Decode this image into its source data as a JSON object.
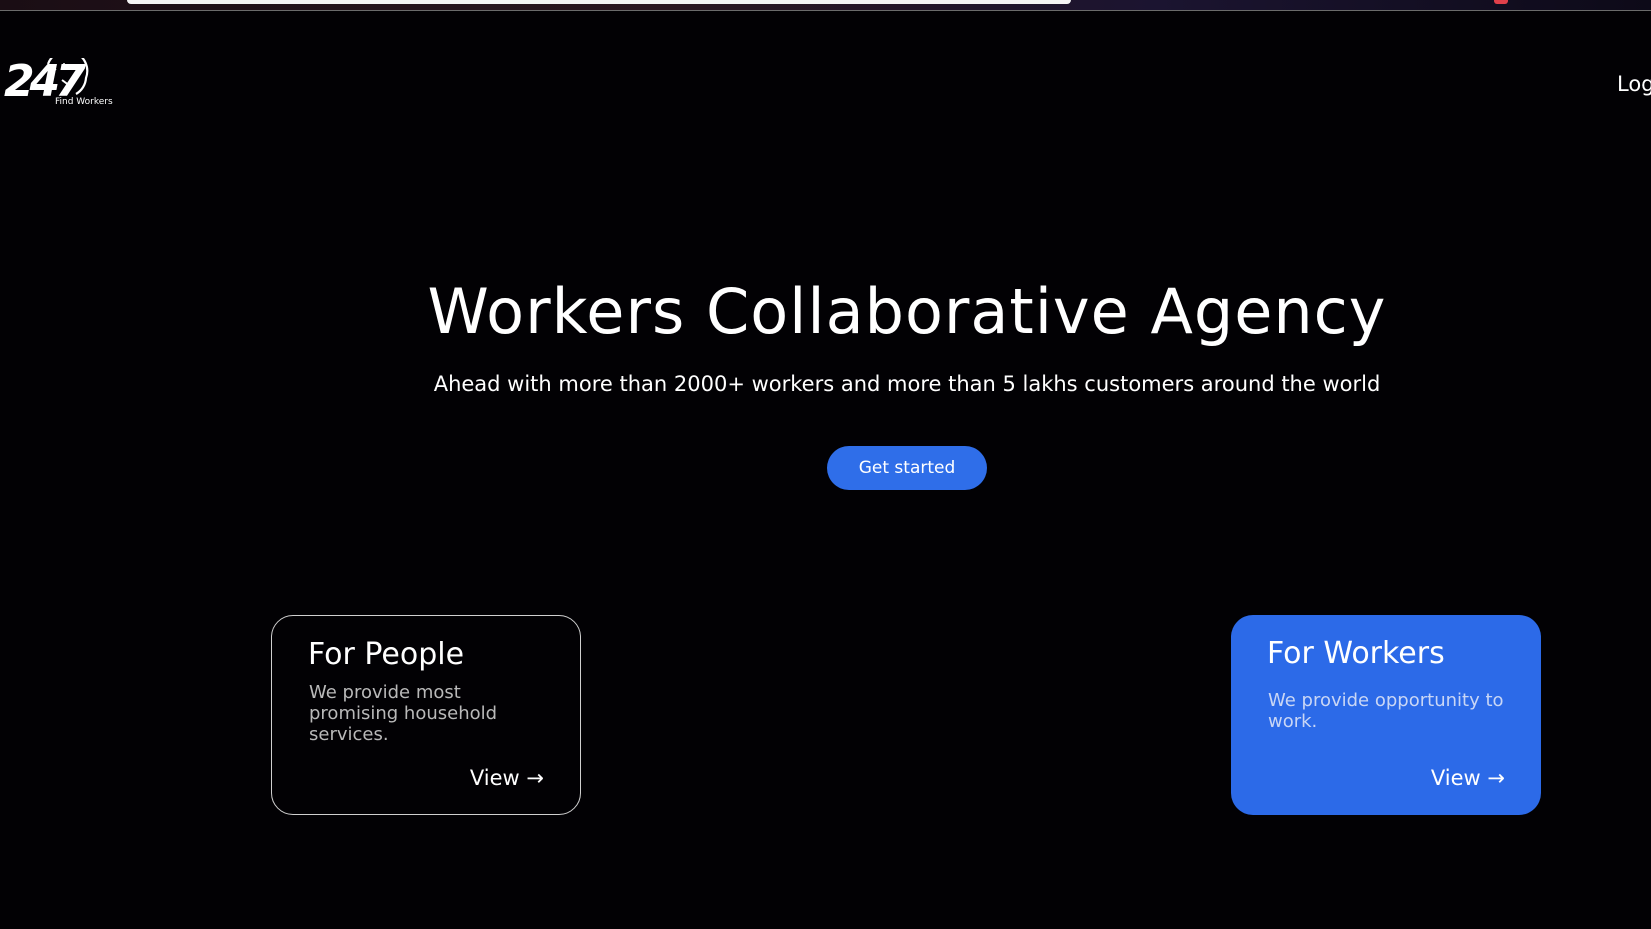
{
  "logo": {
    "mark": "247",
    "sub": "Find Workers"
  },
  "nav": {
    "login": "Log"
  },
  "hero": {
    "title": "Workers Collaborative Agency",
    "subtitle": "Ahead with more than 2000+ workers and more than 5 lakhs customers around the world",
    "cta": "Get started"
  },
  "cards": {
    "people": {
      "title": "For People",
      "description": "We provide most promising household services.",
      "link": "View →"
    },
    "workers": {
      "title": "For Workers",
      "description": "We provide opportunity to work.",
      "link": "View →"
    }
  },
  "colors": {
    "background": "#020104",
    "accent": "#2f6ee9",
    "text": "#ffffff"
  }
}
